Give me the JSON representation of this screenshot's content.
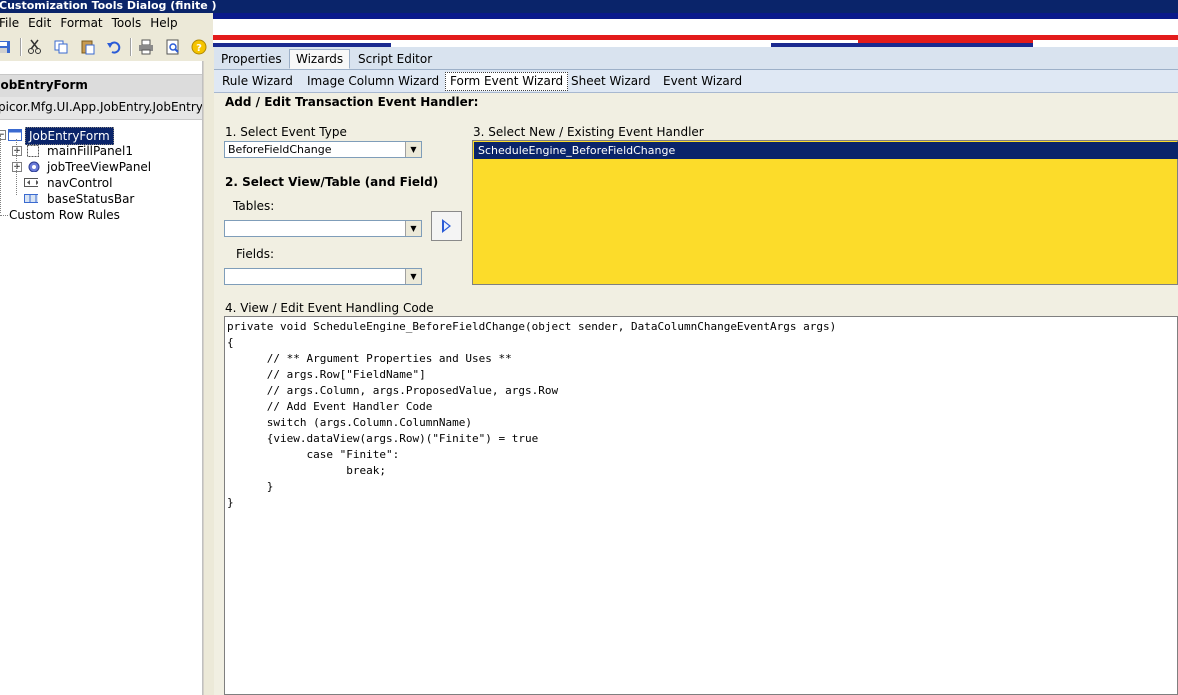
{
  "window": {
    "title": "Customization Tools Dialog  (finite )"
  },
  "menu": [
    "File",
    "Edit",
    "Format",
    "Tools",
    "Help"
  ],
  "toolbar": [
    "save-icon",
    "cut-icon",
    "copy-icon",
    "paste-icon",
    "undo-icon",
    "print-icon",
    "print-preview-icon",
    "help-icon"
  ],
  "left_panel": {
    "form_name": "JobEntryForm",
    "namespace": "picor.Mfg.UI.App.JobEntry.JobEntry",
    "tree": {
      "root": "JobEntryForm",
      "children": [
        "mainFillPanel1",
        "jobTreeViewPanel",
        "navControl",
        "baseStatusBar"
      ],
      "custom_rules": "Custom Row Rules"
    }
  },
  "tabs": [
    "Properties",
    "Wizards",
    "Script Editor"
  ],
  "active_tab": "Wizards",
  "wizard_tabs": [
    "Rule Wizard",
    "Image Column Wizard",
    "Form Event Wizard",
    "Sheet Wizard",
    "Event Wizard"
  ],
  "active_wizard_tab": "Form Event Wizard",
  "wizard": {
    "heading": "Add / Edit Transaction Event Handler:",
    "step1_label": "1. Select Event Type",
    "event_type": "BeforeFieldChange",
    "step2_label": "2. Select View/Table (and Field)",
    "tables_label": "Tables:",
    "tables_value": "",
    "fields_label": "Fields:",
    "fields_value": "",
    "step3_label": "3. Select New / Existing Event Handler",
    "handlers": [
      "ScheduleEngine_BeforeFieldChange"
    ],
    "step4_label": "4. View / Edit Event Handling Code",
    "code": "private void ScheduleEngine_BeforeFieldChange(object sender, DataColumnChangeEventArgs args)\n{\n\t// ** Argument Properties and Uses **\n\t// args.Row[\"FieldName\"]\n\t// args.Column, args.ProposedValue, args.Row\n\t// Add Event Handler Code\n\tswitch (args.Column.ColumnName)\n\t{view.dataView(args.Row)(\"Finite\") = true\n\t\tcase \"Finite\":\n\t\t\tbreak;\n\t}\n}"
  },
  "colors": {
    "handler_list_bg": "#fcdc2a",
    "selection": "#0a246a",
    "titlebar": "#0a246a"
  }
}
